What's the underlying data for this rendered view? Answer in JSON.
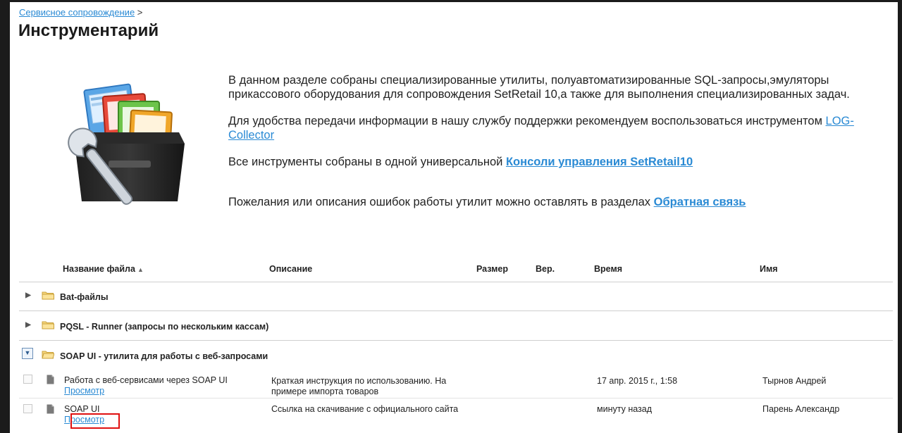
{
  "breadcrumb": {
    "link": "Сервисное сопровождение",
    "separator": ">"
  },
  "page_title": "Инструментарий",
  "illustration": {
    "icon": "toolbox-folders-wrench-icon"
  },
  "intro": {
    "p1": "В данном разделе собраны специализированные утилиты, полуавтоматизированные SQL-запросы,эмуляторы прикассового оборудования для сопровождения SetRetail 10,а также для выполнения специализированных задач.",
    "p2_text": "Для удобства передачи информации в нашу службу поддержки рекомендуем воспользоваться инструментом ",
    "p2_link": "LOG-Collector",
    "p3_text": "Все инструменты собраны в одной универсальной ",
    "p3_link": "Консоли управления SetRetail10",
    "p4_text": "Пожелания или описания ошибок работы утилит можно оставлять в разделах ",
    "p4_link": "Обратная связь"
  },
  "table": {
    "headers": {
      "name": "Название файла",
      "description": "Описание",
      "size": "Размер",
      "version": "Вер.",
      "time": "Время",
      "author": "Имя"
    },
    "sort_indicator": "▲",
    "groups": [
      {
        "label": "Bat-файлы",
        "toggle": "▶",
        "expanded": false
      },
      {
        "label": "PQSL - Runner (запросы по нескольким кассам)",
        "toggle": "▶",
        "expanded": false
      },
      {
        "label": "SOAP UI - утилита для работы с веб-запросами",
        "toggle": "▼",
        "expanded": true
      }
    ],
    "rows": [
      {
        "name": "Работа с веб-сервисами через SOAP UI",
        "view_link": "Просмотр",
        "description": "Краткая инструкция по использованию. На примере импорта товаров",
        "size": "",
        "version": "",
        "time": "17 апр. 2015 г., 1:58",
        "author": "Тырнов Андрей"
      },
      {
        "name": "SOAP UI",
        "view_link": "Просмотр",
        "description": "Ссылка на скачивание с официального сайта",
        "size": "",
        "version": "",
        "time": "минуту назад",
        "author": "Парень Александр"
      }
    ]
  },
  "colors": {
    "link": "#2a8ad4",
    "highlight": "#e01010",
    "frame": "#1b1b1b"
  }
}
